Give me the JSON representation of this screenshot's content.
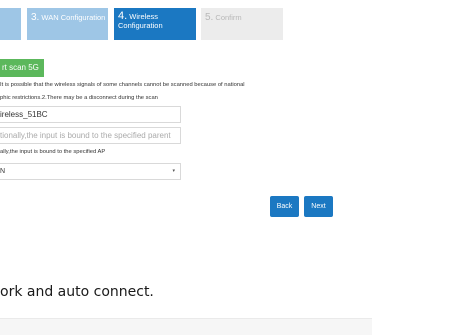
{
  "steps": [
    {
      "num": "",
      "label": ""
    },
    {
      "num": "3.",
      "label": " WAN Configuration"
    },
    {
      "num": "4.",
      "label": " Wireless",
      "label2": "Configuration"
    },
    {
      "num": "5.",
      "label": " Confirm"
    }
  ],
  "scan_button": "rt scan 5G",
  "hint": {
    "line1": "It is possible that the wireless signals of some channels cannot be scanned because of national",
    "line2": "phic restrictions.2.There may be a disconnect during the scan"
  },
  "ssid_field": {
    "value": "ireless_51BC"
  },
  "parent_field": {
    "placeholder": "tionally,the input is bound to the specified parent"
  },
  "ap_hint": "ally,the input is bound to the specified AP",
  "select": {
    "value": "N",
    "arrow": "▾"
  },
  "buttons": {
    "back": "Back",
    "next": "Next"
  },
  "caption": "ork and auto connect."
}
